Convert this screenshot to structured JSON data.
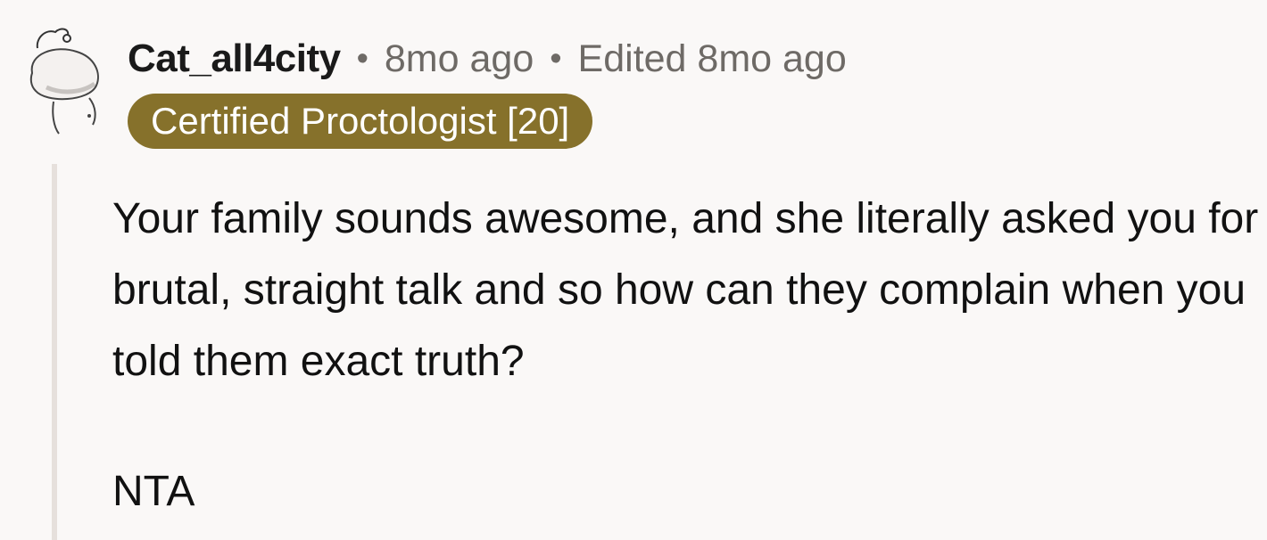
{
  "comment": {
    "author": "Cat_all4city",
    "separator": "•",
    "posted": "8mo ago",
    "edited": "Edited 8mo ago",
    "flair": "Certified Proctologist [20]",
    "flair_color": "#86712b",
    "avatar_icon": "snoo-avatar-icon",
    "paragraphs": [
      "Your family sounds awesome, and she literally asked you for brutal, straight talk and so how can they complain when you told them exact truth?",
      "NTA"
    ]
  }
}
